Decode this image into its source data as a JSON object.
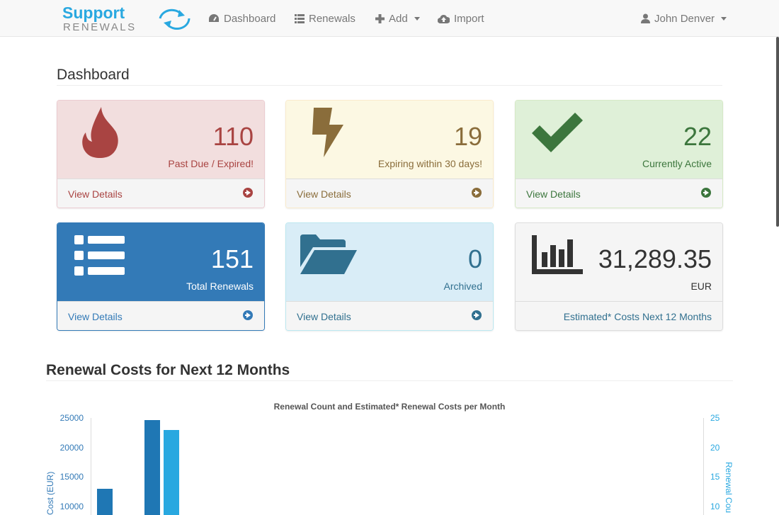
{
  "brand": {
    "top": "Support",
    "bottom": "RENEWALS"
  },
  "nav": {
    "dashboard": "Dashboard",
    "renewals": "Renewals",
    "add": "Add",
    "import": "Import",
    "user": "John Denver"
  },
  "page": {
    "title": "Dashboard"
  },
  "panels": [
    {
      "value": "110",
      "label": "Past Due / Expired!",
      "footer": "View Details",
      "icon": "fire-icon"
    },
    {
      "value": "19",
      "label": "Expiring within 30 days!",
      "footer": "View Details",
      "icon": "bolt-icon"
    },
    {
      "value": "22",
      "label": "Currently Active",
      "footer": "View Details",
      "icon": "check-icon"
    },
    {
      "value": "151",
      "label": "Total Renewals",
      "footer": "View Details",
      "icon": "list-icon"
    },
    {
      "value": "0",
      "label": "Archived",
      "footer": "View Details",
      "icon": "folder-open-icon"
    },
    {
      "value": "31,289.35",
      "label": "EUR",
      "footer": "Estimated* Costs Next 12 Months",
      "icon": "bar-chart-icon"
    }
  ],
  "colors": {
    "danger": "#a94442",
    "warning": "#8a6d3b",
    "success": "#3c763d",
    "primary": "#337ab7",
    "info": "#31708f",
    "bar_cost": "#1f77b4",
    "bar_count": "#29a8e0"
  },
  "section": {
    "title": "Renewal Costs for Next 12 Months"
  },
  "chart_data": {
    "type": "bar",
    "title": "Renewal Count and Estimated* Renewal Costs per Month",
    "ylabel": "Cost (EUR)",
    "ylabel_right": "Renewal Cou",
    "left_ticks": [
      "25000",
      "20000",
      "15000",
      "10000"
    ],
    "right_ticks": [
      "25",
      "20",
      "15",
      "10"
    ],
    "ylim": [
      0,
      25000
    ],
    "ylim_right": [
      0,
      25
    ],
    "series": [
      {
        "values": [
          13000,
          24700
        ]
      },
      {
        "values": [
          23000
        ]
      }
    ]
  }
}
